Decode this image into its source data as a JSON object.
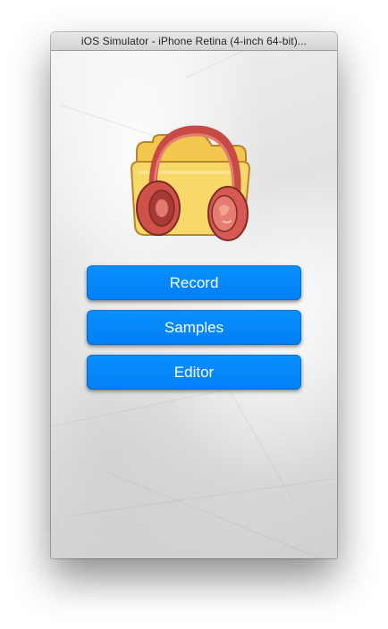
{
  "window": {
    "title": "iOS Simulator - iPhone Retina (4-inch 64-bit)..."
  },
  "app": {
    "logo_icon": "folder-headphones-icon",
    "buttons": {
      "record": "Record",
      "samples": "Samples",
      "editor": "Editor"
    }
  },
  "colors": {
    "button_blue": "#0a8bff",
    "button_text": "#ffffff",
    "folder_yellow": "#f6cf5a",
    "headphones_red": "#d9594f"
  }
}
